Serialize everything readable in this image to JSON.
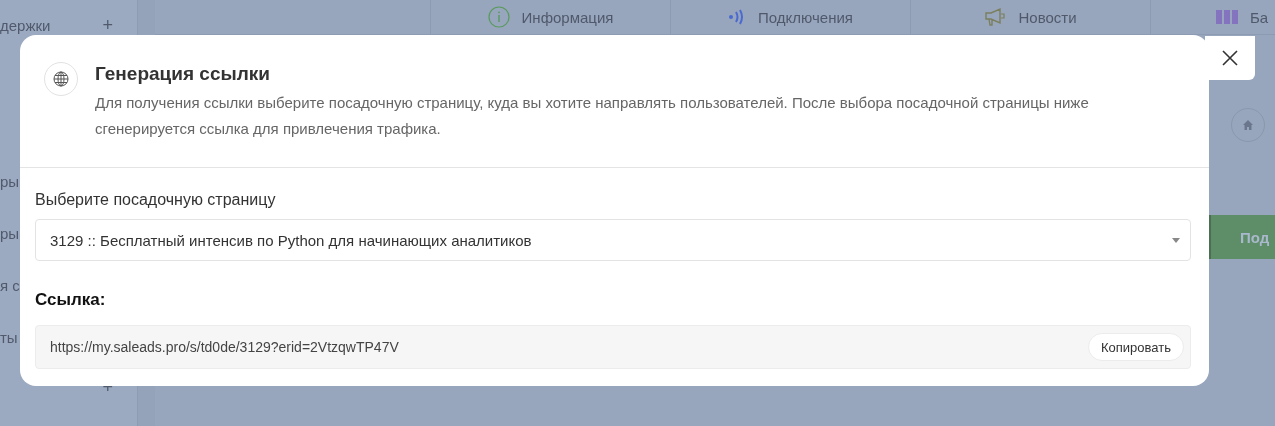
{
  "sidebar": {
    "top_item": {
      "label": "держки",
      "toggle": "+"
    },
    "items": [
      "ры",
      "ры",
      "я с",
      "ты"
    ],
    "bottom_toggle": "+"
  },
  "tabs": [
    {
      "label": "Информация",
      "kind": "info"
    },
    {
      "label": "Подключения",
      "kind": "signal"
    },
    {
      "label": "Новости",
      "kind": "megaphone"
    },
    {
      "label": "Ба",
      "kind": "bars"
    }
  ],
  "side_panel": {
    "action_button": "Под"
  },
  "modal": {
    "title": "Генерация ссылки",
    "description": "Для получения ссылки выберите посадочную страницу, куда вы хотите направлять пользователей. После выбора посадочной страницы ниже сгенерируется ссылка для привлечения трафика.",
    "select_label": "Выберите посадочную страницу",
    "select_value": "3129 :: Бесплатный интенсив по Python для начинающих аналитиков",
    "link_label": "Ссылка:",
    "link_value": "https://my.saleads.pro/s/td0de/3129?erid=2VtzqwTP47V",
    "copy_button": "Копировать"
  }
}
